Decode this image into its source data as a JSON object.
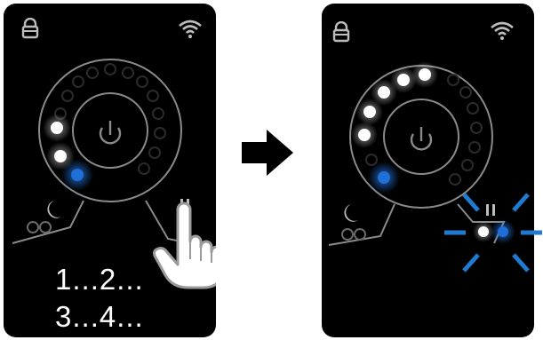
{
  "before": {
    "lit_dots": 3,
    "active_dot_color": "#1e6fd6",
    "instruction_lines": [
      "1...2...",
      "3...4..."
    ]
  },
  "after": {
    "lit_dots": 6,
    "active_dot_color": "#1e6fd6",
    "pair_indicator": "blinking-blue"
  },
  "colors": {
    "device_body": "#000000",
    "ring_stroke": "#8a8a8a",
    "white_led": "#ffffff",
    "blue_led": "#1e6fd6",
    "blink_rays": "#1e7bd0"
  },
  "icons": [
    "lock-icon",
    "wifi-icon",
    "power-icon",
    "moon-icon",
    "pause-icon",
    "hand-pointer-icon",
    "arrow-right-icon"
  ]
}
